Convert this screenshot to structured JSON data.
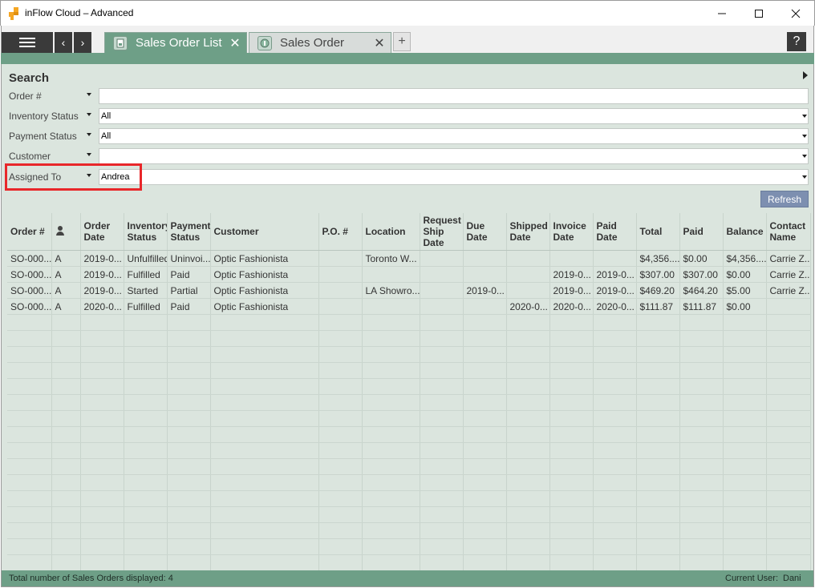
{
  "window": {
    "title": "inFlow Cloud – Advanced",
    "minimize_glyph": "—",
    "maximize_glyph": "☐",
    "close_glyph": "✕"
  },
  "nav": {
    "back_glyph": "‹",
    "forward_glyph": "›",
    "help_glyph": "?"
  },
  "tabs": [
    {
      "label": "Sales Order List",
      "close_glyph": "✕",
      "icon": "sales-order-list-icon",
      "active": true
    },
    {
      "label": "Sales Order",
      "close_glyph": "✕",
      "icon": "sales-order-icon",
      "active": false
    }
  ],
  "add_tab_glyph": "+",
  "search": {
    "title": "Search",
    "fields": [
      {
        "label": "Order #",
        "value": ""
      },
      {
        "label": "Inventory Status",
        "value": "All"
      },
      {
        "label": "Payment Status",
        "value": "All"
      },
      {
        "label": "Customer",
        "value": ""
      },
      {
        "label": "Assigned To",
        "value": "Andrea"
      }
    ],
    "refresh_label": "Refresh"
  },
  "grid": {
    "columns": [
      "Order #",
      "",
      "Order Date",
      "Inventory Status",
      "Payment Status",
      "Customer",
      "P.O. #",
      "Location",
      "Request Ship Date",
      "Due Date",
      "Shipped Date",
      "Invoice Date",
      "Paid Date",
      "Total",
      "Paid",
      "Balance",
      "Contact Name"
    ],
    "rows": [
      [
        "SO-000...",
        "A",
        "2019-0...",
        "Unfulfilled",
        "Uninvoi...",
        "Optic Fashionista",
        "",
        "Toronto W...",
        "",
        "",
        "",
        "",
        "",
        "$4,356....",
        "$0.00",
        "$4,356....",
        "Carrie Z..."
      ],
      [
        "SO-000...",
        "A",
        "2019-0...",
        "Fulfilled",
        "Paid",
        "Optic Fashionista",
        "",
        "",
        "",
        "",
        "",
        "2019-0...",
        "2019-0...",
        "$307.00",
        "$307.00",
        "$0.00",
        "Carrie Z..."
      ],
      [
        "SO-000...",
        "A",
        "2019-0...",
        "Started",
        "Partial",
        "Optic Fashionista",
        "",
        "LA Showro...",
        "",
        "2019-0...",
        "",
        "2019-0...",
        "2019-0...",
        "$469.20",
        "$464.20",
        "$5.00",
        "Carrie Z..."
      ],
      [
        "SO-000...",
        "A",
        "2020-0...",
        "Fulfilled",
        "Paid",
        "Optic Fashionista",
        "",
        "",
        "",
        "",
        "2020-0...",
        "2020-0...",
        "2020-0...",
        "$111.87",
        "$111.87",
        "$0.00",
        ""
      ]
    ]
  },
  "status": {
    "summary": "Total number of Sales Orders displayed: 4",
    "user_label": "Current User:",
    "user": "Dani"
  },
  "colors": {
    "accent_green": "#6e9f87",
    "panel_bg": "#dbe5de",
    "highlight_red": "#e8272a",
    "refresh_bg": "#7d8fb0"
  }
}
